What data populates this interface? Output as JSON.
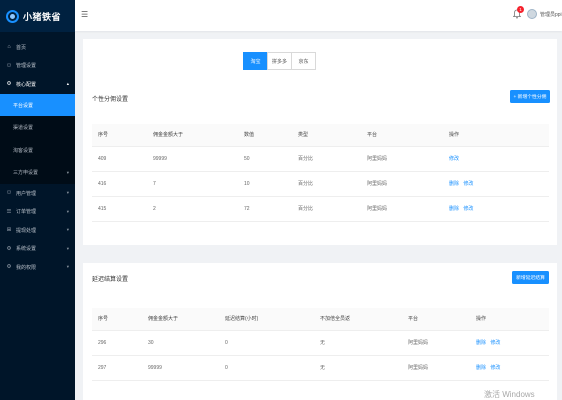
{
  "app": {
    "name": "小猪铁省"
  },
  "sidebar": {
    "items": [
      {
        "icon": "⌂",
        "label": "首页"
      },
      {
        "icon": "⚇",
        "label": "管理设置"
      },
      {
        "icon": "⚙",
        "label": "核心配置",
        "open": true,
        "chev": "▴"
      },
      {
        "icon": "⚇",
        "label": "用户管理",
        "chev": "▾"
      },
      {
        "icon": "☰",
        "label": "订单管理",
        "chev": "▾"
      },
      {
        "icon": "⊞",
        "label": "提现处理",
        "chev": "▾"
      },
      {
        "icon": "⚙",
        "label": "系统设置",
        "chev": "▾"
      },
      {
        "icon": "⚙",
        "label": "我的权限",
        "chev": "▾"
      }
    ],
    "submenu": [
      {
        "label": "平台设置",
        "active": true
      },
      {
        "label": "渠道设置"
      },
      {
        "label": "淘客设置"
      },
      {
        "label": "三方申设置",
        "chev": "▾"
      }
    ]
  },
  "header": {
    "fold_icon": "☰",
    "notification_count": "1",
    "username": "管理员ppi"
  },
  "platform_tabs": [
    "淘宝",
    "拼多多",
    "京东"
  ],
  "active_tab": 0,
  "section1": {
    "title": "个性分佣设置",
    "add_button": "+ 新增个性分佣",
    "columns": [
      "序号",
      "佣金金额大于",
      "数值",
      "类型",
      "平台",
      "操作"
    ],
    "rows": [
      {
        "id": "409",
        "amount": "99999",
        "value": "50",
        "type": "百分比",
        "platform": "阿里妈妈",
        "actions": [
          "修改"
        ]
      },
      {
        "id": "416",
        "amount": "7",
        "value": "10",
        "type": "百分比",
        "platform": "阿里妈妈",
        "actions": [
          "删除",
          "修改"
        ]
      },
      {
        "id": "415",
        "amount": "2",
        "value": "72",
        "type": "百分比",
        "platform": "阿里妈妈",
        "actions": [
          "删除",
          "修改"
        ]
      }
    ]
  },
  "section2": {
    "title": "延迟结算设置",
    "add_button": "新增延迟结算",
    "columns": [
      "序号",
      "佣金金额大于",
      "延迟结算(小时)",
      "不加倍全员返",
      "平台",
      "操作"
    ],
    "rows": [
      {
        "id": "296",
        "amount": "30",
        "delay": "0",
        "flag": "无",
        "platform": "阿里妈妈",
        "actions": [
          "删除",
          "修改"
        ]
      },
      {
        "id": "297",
        "amount": "99999",
        "delay": "0",
        "flag": "无",
        "platform": "阿里妈妈",
        "actions": [
          "删除",
          "修改"
        ]
      }
    ]
  },
  "watermark": "激活 Windows",
  "colors": {
    "sidebar": "#001529",
    "primary": "#1890ff",
    "badge": "#f5222d"
  }
}
